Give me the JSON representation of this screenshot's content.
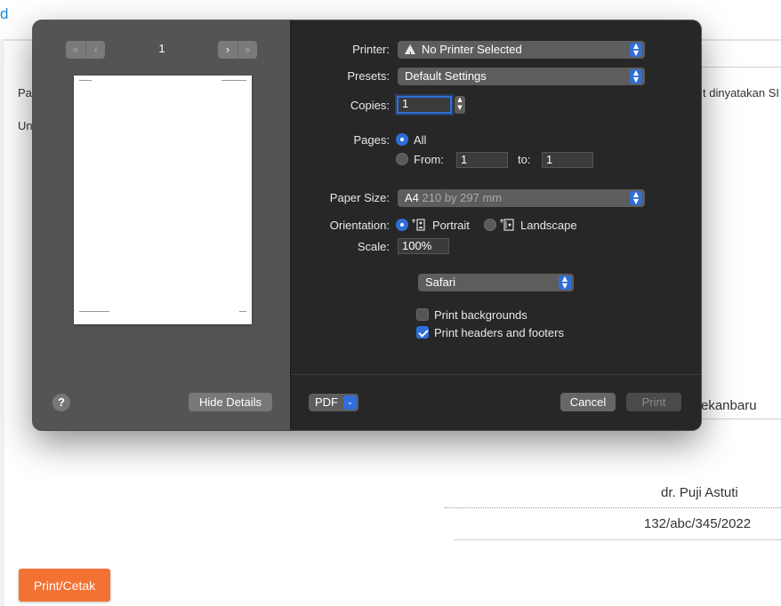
{
  "background": {
    "corner_char": "d",
    "left_text_1": "Pa",
    "left_text_2": "Un",
    "right_text": "t dinyatakan SI",
    "city_fragment": "ekanbaru",
    "doctor_name": "dr. Puji Astuti",
    "doc_number": "132/abc/345/2022",
    "print_button_label": "Print/Cetak"
  },
  "preview": {
    "page_number": "1",
    "nav_first": "«",
    "nav_prev": "‹",
    "nav_next": "›",
    "nav_last": "»",
    "help_label": "?",
    "hide_details_label": "Hide Details"
  },
  "settings": {
    "printer_label": "Printer:",
    "printer_value": "No Printer Selected",
    "presets_label": "Presets:",
    "presets_value": "Default Settings",
    "copies_label": "Copies:",
    "copies_value": "1",
    "pages_label": "Pages:",
    "pages_all": "All",
    "pages_from": "From:",
    "pages_from_value": "1",
    "pages_to": "to:",
    "pages_to_value": "1",
    "paper_size_label": "Paper Size:",
    "paper_size_name": "A4",
    "paper_size_dims": "210 by 297 mm",
    "orientation_label": "Orientation:",
    "portrait": "Portrait",
    "landscape": "Landscape",
    "scale_label": "Scale:",
    "scale_value": "100%",
    "app_section": "Safari",
    "print_backgrounds": "Print backgrounds",
    "print_headers_footers": "Print headers and footers",
    "print_backgrounds_checked": false,
    "print_headers_footers_checked": true,
    "pages_selected": "All",
    "orientation_selected": "Portrait"
  },
  "footer": {
    "pdf_label": "PDF",
    "cancel_label": "Cancel",
    "print_label": "Print"
  },
  "colors": {
    "accent": "#2f6ed9",
    "print_cetak": "#f37133",
    "link": "#1e8ad6"
  }
}
